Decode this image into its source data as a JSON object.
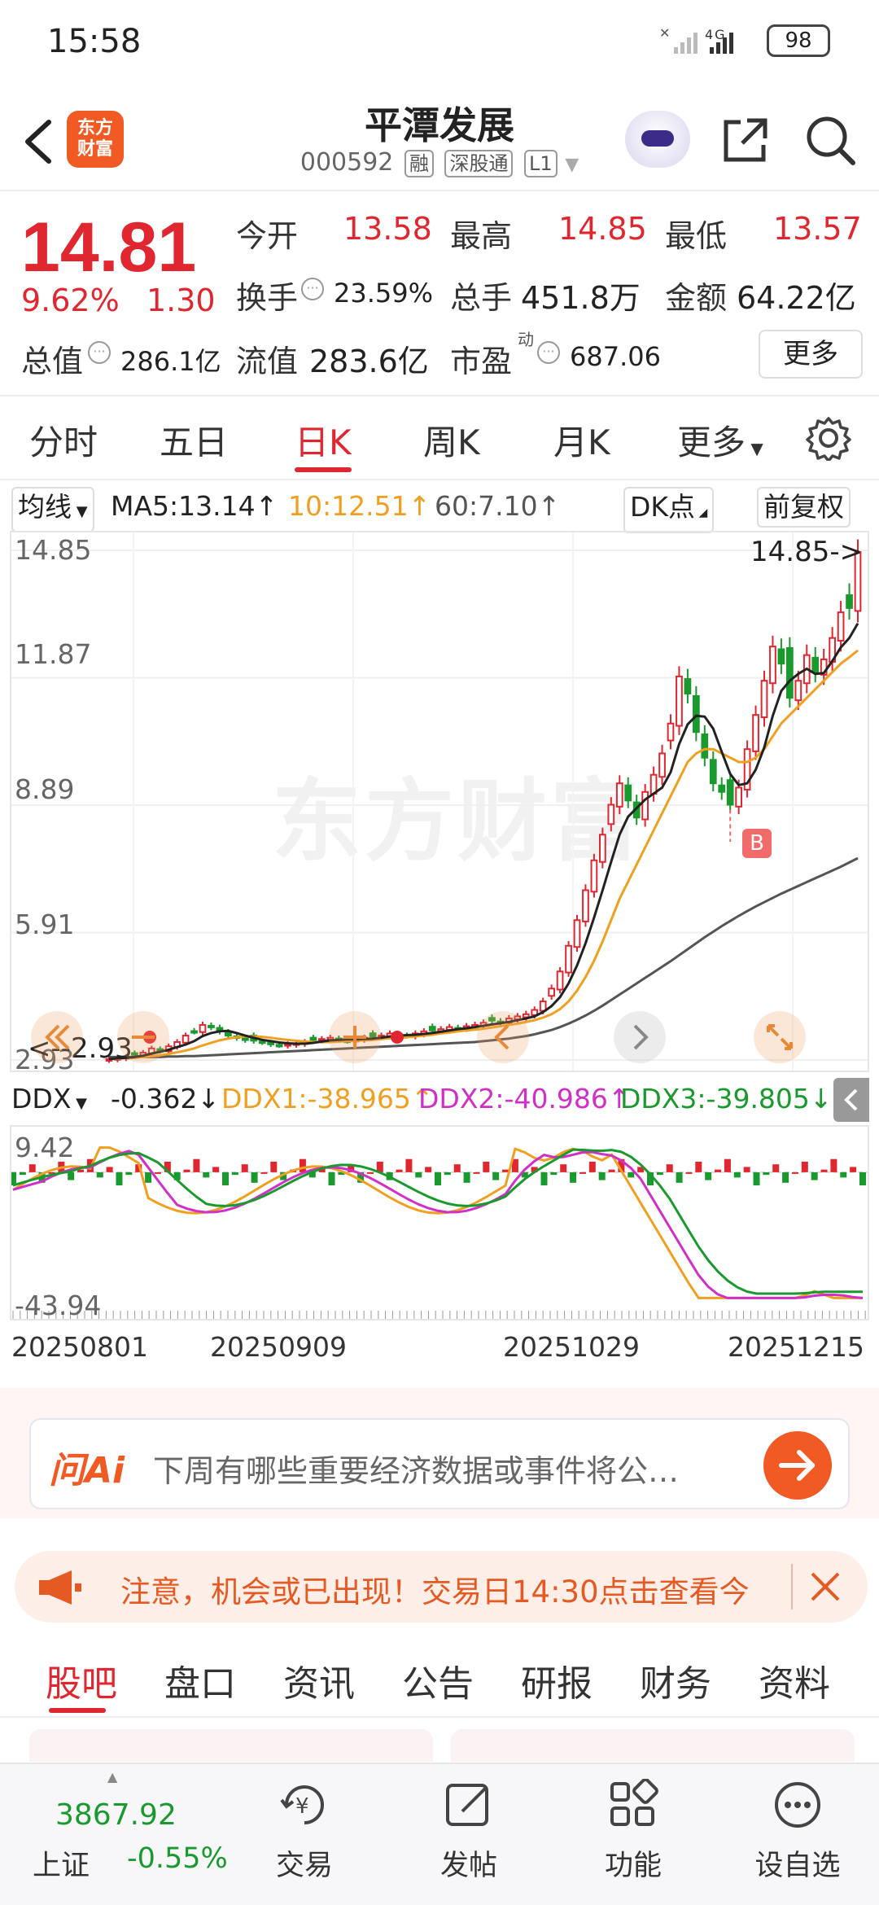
{
  "status_bar": {
    "time": "15:58",
    "signal": "4G",
    "battery": "98"
  },
  "header": {
    "title": "平潭发展",
    "code": "000592",
    "tags": [
      "融",
      "深股通",
      "L1"
    ],
    "logo_text_top": "东方",
    "logo_text_bottom": "财富"
  },
  "quote": {
    "price": "14.81",
    "change_pct": "9.62%",
    "change": "1.30",
    "open_label": "今开",
    "open": "13.58",
    "high_label": "最高",
    "high": "14.85",
    "low_label": "最低",
    "low": "13.57",
    "turnover_label": "换手",
    "turnover": "23.59%",
    "volume_label": "总手",
    "volume": "451.8万",
    "amount_label": "金额",
    "amount": "64.22亿",
    "mktcap_label": "总值",
    "mktcap": "286.1亿",
    "float_label": "流值",
    "float": "283.6亿",
    "pe_label": "市盈",
    "pe_sup": "动",
    "pe": "687.06",
    "more": "更多",
    "up_color": "#e0262f"
  },
  "period_tabs": [
    {
      "label": "分时"
    },
    {
      "label": "五日"
    },
    {
      "label": "日K",
      "active": true
    },
    {
      "label": "周K"
    },
    {
      "label": "月K"
    },
    {
      "label": "更多"
    }
  ],
  "ma_row": {
    "selector": "均线",
    "ma5": "MA5:13.14↑",
    "ma10": "10:12.51↑",
    "ma60": "60:7.10↑",
    "dk": "DK点",
    "adjust": "前复权"
  },
  "chart": {
    "y_labels": [
      "14.85",
      "11.87",
      "8.89",
      "5.91",
      "2.93"
    ],
    "max_label": "14.85->",
    "min_label": "<--2.93",
    "b_marker": "B",
    "watermark": "东方财富"
  },
  "chart_data": {
    "type": "candlestick",
    "ylim": [
      2.93,
      14.85
    ],
    "closes": [
      2.95,
      2.98,
      3.0,
      3.05,
      3.1,
      3.2,
      3.15,
      3.25,
      3.35,
      3.5,
      3.6,
      3.75,
      3.7,
      3.6,
      3.5,
      3.45,
      3.4,
      3.38,
      3.35,
      3.3,
      3.28,
      3.3,
      3.32,
      3.35,
      3.4,
      3.42,
      3.45,
      3.4,
      3.38,
      3.42,
      3.45,
      3.48,
      3.5,
      3.55,
      3.52,
      3.5,
      3.55,
      3.6,
      3.62,
      3.65,
      3.7,
      3.68,
      3.72,
      3.75,
      3.8,
      3.85,
      3.82,
      3.9,
      3.95,
      4.0,
      4.1,
      4.3,
      4.6,
      5.0,
      5.6,
      6.2,
      6.9,
      7.6,
      8.2,
      8.9,
      9.4,
      9.0,
      8.6,
      9.2,
      9.6,
      10.1,
      10.8,
      11.9,
      11.5,
      10.6,
      10.0,
      9.4,
      9.2,
      8.9,
      9.3,
      10.2,
      11.0,
      11.8,
      12.6,
      12.2,
      11.4,
      11.8,
      12.4,
      12.0,
      12.3,
      12.8,
      13.4,
      13.5,
      14.81
    ],
    "ma5": [
      2.95,
      2.97,
      2.98,
      3.0,
      3.03,
      3.08,
      3.12,
      3.17,
      3.23,
      3.29,
      3.37,
      3.49,
      3.56,
      3.6,
      3.61,
      3.56,
      3.5,
      3.45,
      3.4,
      3.37,
      3.34,
      3.32,
      3.31,
      3.31,
      3.33,
      3.36,
      3.39,
      3.4,
      3.41,
      3.41,
      3.42,
      3.43,
      3.45,
      3.48,
      3.5,
      3.51,
      3.52,
      3.54,
      3.56,
      3.59,
      3.62,
      3.65,
      3.67,
      3.7,
      3.73,
      3.76,
      3.79,
      3.82,
      3.86,
      3.9,
      3.95,
      4.05,
      4.19,
      4.4,
      4.72,
      5.14,
      5.66,
      6.26,
      6.9,
      7.56,
      8.2,
      8.62,
      8.82,
      9.02,
      9.16,
      9.3,
      9.66,
      10.32,
      10.78,
      10.98,
      10.96,
      10.68,
      10.14,
      9.62,
      9.36,
      9.4,
      9.72,
      10.24,
      10.98,
      11.56,
      11.8,
      11.96,
      12.08,
      11.96,
      11.98,
      12.26,
      12.58,
      12.8,
      13.14
    ],
    "ma10": [
      2.95,
      2.96,
      2.97,
      2.98,
      3.0,
      3.02,
      3.04,
      3.07,
      3.11,
      3.15,
      3.2,
      3.27,
      3.33,
      3.39,
      3.43,
      3.46,
      3.48,
      3.48,
      3.47,
      3.45,
      3.42,
      3.4,
      3.38,
      3.36,
      3.35,
      3.35,
      3.35,
      3.36,
      3.37,
      3.38,
      3.39,
      3.4,
      3.42,
      3.44,
      3.45,
      3.46,
      3.48,
      3.5,
      3.52,
      3.55,
      3.57,
      3.6,
      3.62,
      3.64,
      3.66,
      3.69,
      3.72,
      3.75,
      3.78,
      3.82,
      3.86,
      3.92,
      4.0,
      4.12,
      4.3,
      4.55,
      4.87,
      5.25,
      5.7,
      6.2,
      6.7,
      7.1,
      7.5,
      7.9,
      8.3,
      8.7,
      9.1,
      9.5,
      9.9,
      10.1,
      10.2,
      10.2,
      10.1,
      10.0,
      9.9,
      9.9,
      10.0,
      10.2,
      10.5,
      10.8,
      11.0,
      11.2,
      11.4,
      11.6,
      11.8,
      12.0,
      12.2,
      12.35,
      12.51
    ],
    "ma60": [
      3.0,
      3.0,
      3.0,
      3.0,
      3.0,
      3.0,
      3.0,
      3.01,
      3.01,
      3.02,
      3.02,
      3.03,
      3.04,
      3.05,
      3.06,
      3.07,
      3.08,
      3.09,
      3.1,
      3.11,
      3.12,
      3.13,
      3.14,
      3.15,
      3.16,
      3.17,
      3.18,
      3.19,
      3.2,
      3.21,
      3.22,
      3.23,
      3.24,
      3.25,
      3.26,
      3.27,
      3.28,
      3.29,
      3.3,
      3.31,
      3.32,
      3.33,
      3.34,
      3.35,
      3.37,
      3.39,
      3.41,
      3.43,
      3.46,
      3.49,
      3.53,
      3.58,
      3.63,
      3.7,
      3.78,
      3.87,
      3.97,
      4.08,
      4.2,
      4.33,
      4.46,
      4.59,
      4.72,
      4.85,
      4.98,
      5.11,
      5.24,
      5.38,
      5.52,
      5.66,
      5.8,
      5.93,
      6.06,
      6.18,
      6.3,
      6.41,
      6.52,
      6.62,
      6.72,
      6.82,
      6.91,
      7.0,
      7.09,
      7.18,
      7.27,
      7.36,
      7.45,
      7.55,
      7.65
    ],
    "ddx": {
      "ddx": "-0.362",
      "ddx1": "-38.965",
      "ddx2": "-40.986",
      "ddx3": "-39.805",
      "ylim": [
        -43.94,
        9.42
      ]
    },
    "x_dates": [
      "20250801",
      "20250909",
      "20251029",
      "20251215"
    ]
  },
  "ddx_row": {
    "selector": "DDX",
    "ddx": "-0.362↓",
    "ddx1": "DDX1:-38.965↑",
    "ddx2": "DDX2:-40.986↑",
    "ddx3": "DDX3:-39.805↓",
    "y_top": "9.42",
    "y_bottom": "-43.94"
  },
  "ai": {
    "logo": "问Ai",
    "text": "下周有哪些重要经济数据或事件将公…"
  },
  "notice": {
    "text": "注意，机会或已出现！交易日14:30点击查看今"
  },
  "bottom_tabs": [
    {
      "label": "股吧",
      "active": true
    },
    {
      "label": "盘口"
    },
    {
      "label": "资讯"
    },
    {
      "label": "公告"
    },
    {
      "label": "研报"
    },
    {
      "label": "财务"
    },
    {
      "label": "资料"
    }
  ],
  "nav": {
    "index_value": "3867.92",
    "index_name": "上证",
    "index_change": "-0.55%",
    "items": [
      {
        "label": "交易"
      },
      {
        "label": "发帖"
      },
      {
        "label": "功能"
      },
      {
        "label": "设自选"
      }
    ]
  },
  "colors": {
    "up": "#e0262f",
    "down": "#1a9a2e",
    "ma5": "#222222",
    "ma10": "#f0a020",
    "ma60": "#555555",
    "accent": "#f15a22",
    "ddx2": "#d030c8"
  }
}
